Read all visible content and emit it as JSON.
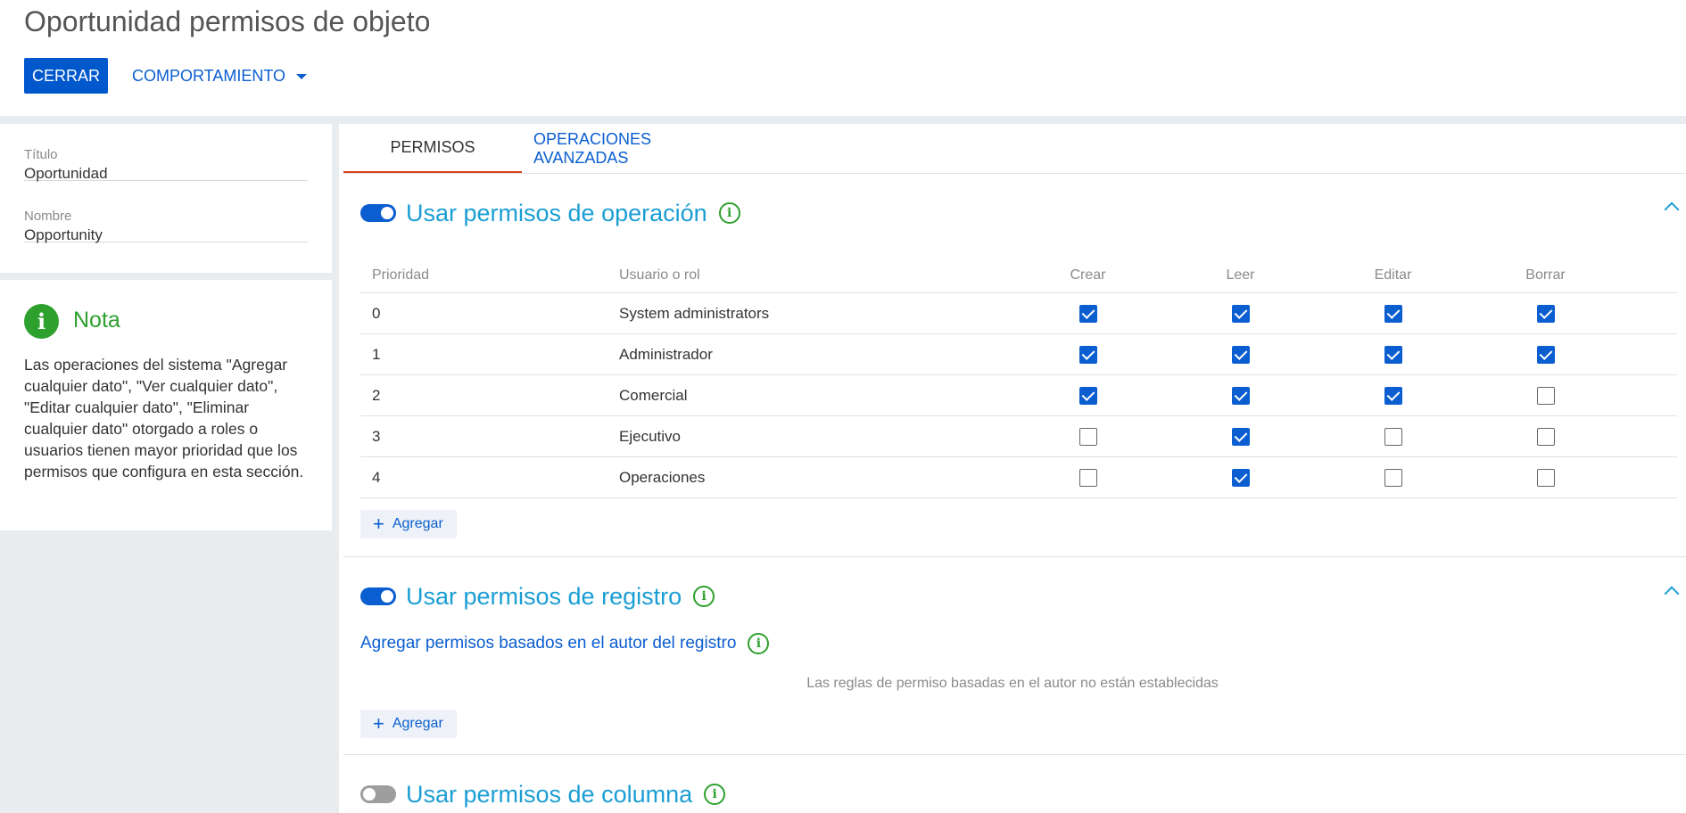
{
  "header": {
    "title": "Oportunidad permisos de objeto",
    "close_label": "CERRAR",
    "behaviour_label": "COMPORTAMIENTO"
  },
  "properties": {
    "title_label": "Título",
    "title_value": "Oportunidad",
    "name_label": "Nombre",
    "name_value": "Opportunity"
  },
  "note": {
    "icon": "i",
    "title": "Nota",
    "text": "Las operaciones del sistema \"Agregar cualquier dato\", \"Ver cualquier dato\", \"Editar cualquier dato\", \"Eliminar cualquier dato\" otorgado a roles o usuarios tienen mayor prioridad que los permisos que configura en esta sección."
  },
  "tabs": [
    {
      "label": "PERMISOS",
      "active": true
    },
    {
      "label": "OPERACIONES AVANZADAS",
      "active": false
    }
  ],
  "operation_permissions": {
    "title": "Usar permisos de operación",
    "enabled": true,
    "info_icon": "i",
    "columns": [
      "Prioridad",
      "Usuario o rol",
      "Crear",
      "Leer",
      "Editar",
      "Borrar"
    ],
    "rows": [
      {
        "priority": "0",
        "role": "System administrators",
        "create": true,
        "read": true,
        "edit": true,
        "delete": true
      },
      {
        "priority": "1",
        "role": "Administrador",
        "create": true,
        "read": true,
        "edit": true,
        "delete": true
      },
      {
        "priority": "2",
        "role": "Comercial",
        "create": true,
        "read": true,
        "edit": true,
        "delete": false
      },
      {
        "priority": "3",
        "role": "Ejecutivo",
        "create": false,
        "read": true,
        "edit": false,
        "delete": false
      },
      {
        "priority": "4",
        "role": "Operaciones",
        "create": false,
        "read": true,
        "edit": false,
        "delete": false
      }
    ],
    "add_label": "Agregar"
  },
  "record_permissions": {
    "title": "Usar permisos de registro",
    "enabled": true,
    "info_icon": "i",
    "author_title": "Agregar permisos basados en el autor del registro",
    "empty_message": "Las reglas de permiso basadas en el autor no están establecidas",
    "add_label": "Agregar"
  },
  "column_permissions": {
    "title": "Usar permisos de columna",
    "enabled": false,
    "info_icon": "i"
  },
  "colors": {
    "accent": "#0b5ed0",
    "section_title": "#1b9ed4",
    "info_green": "#2ea02e",
    "active_tab_underline": "#d9401d"
  }
}
